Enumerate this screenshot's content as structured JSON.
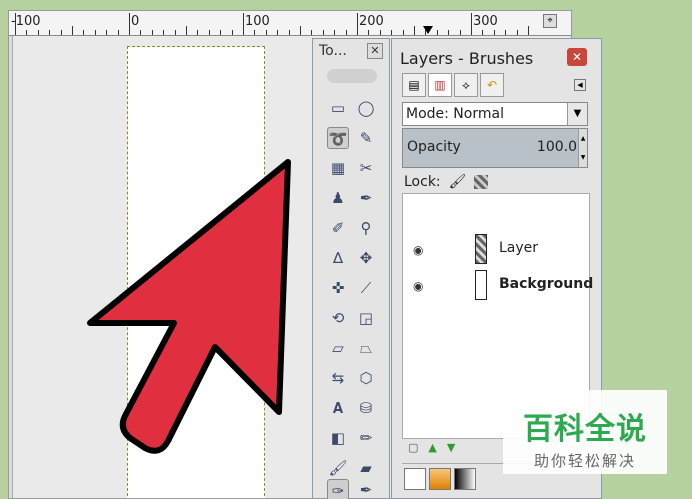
{
  "ruler": {
    "labels": [
      "-100",
      "0",
      "100",
      "200",
      "300"
    ]
  },
  "toolbox": {
    "title": "To...",
    "close_glyph": "✕"
  },
  "layers_dialog": {
    "title": "Layers - Brushes",
    "close_glyph": "✕",
    "mode_label": "Mode: Normal",
    "opacity_label": "Opacity",
    "opacity_value": "100.0",
    "lock_label": "Lock:",
    "layers": [
      {
        "name": "Layer",
        "bold": false
      },
      {
        "name": "Background",
        "bold": true
      }
    ]
  },
  "watermark": {
    "main": "百科全说",
    "sub": "助你轻松解决"
  },
  "colors": {
    "arrow_fill": "#e0303f",
    "background": "#b5d19f",
    "watermark_green": "#2da94f"
  }
}
